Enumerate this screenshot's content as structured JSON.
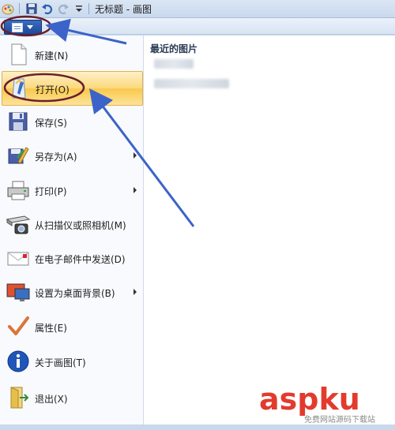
{
  "window": {
    "title": "无标题 - 画图",
    "qat_icons": [
      "paint-icon",
      "save-icon",
      "undo-icon",
      "redo-icon",
      "customize-icon"
    ]
  },
  "app_button": {
    "icon": "app-menu-icon",
    "dropdown": "chevron-down-icon"
  },
  "menu": {
    "items": [
      {
        "label": "新建(N)",
        "icon": "new-file-icon",
        "submenu": false,
        "highlighted": false
      },
      {
        "label": "打开(O)",
        "icon": "open-icon",
        "submenu": false,
        "highlighted": true
      },
      {
        "label": "保存(S)",
        "icon": "save-icon",
        "submenu": false,
        "highlighted": false
      },
      {
        "label": "另存为(A)",
        "icon": "save-as-icon",
        "submenu": true,
        "highlighted": false
      },
      {
        "label": "打印(P)",
        "icon": "printer-icon",
        "submenu": true,
        "highlighted": false
      },
      {
        "label": "从扫描仪或照相机(M)",
        "icon": "scanner-camera-icon",
        "submenu": false,
        "highlighted": false
      },
      {
        "label": "在电子邮件中发送(D)",
        "icon": "email-icon",
        "submenu": false,
        "highlighted": false
      },
      {
        "label": "设置为桌面背景(B)",
        "icon": "desktop-background-icon",
        "submenu": true,
        "highlighted": false
      },
      {
        "label": "属性(E)",
        "icon": "checkmark-icon",
        "submenu": false,
        "highlighted": false
      },
      {
        "label": "关于画图(T)",
        "icon": "info-icon",
        "submenu": false,
        "highlighted": false
      },
      {
        "label": "退出(X)",
        "icon": "exit-icon",
        "submenu": false,
        "highlighted": false
      }
    ],
    "recent_title": "最近的图片"
  },
  "watermark": {
    "main": "aspku",
    "sub": "免费网站源码下载站"
  },
  "colors": {
    "highlight": "#f9c84b",
    "annotation_arrow": "#3b63c9",
    "annotation_circle": "#6b1f2a",
    "watermark": "#e23b2e"
  }
}
